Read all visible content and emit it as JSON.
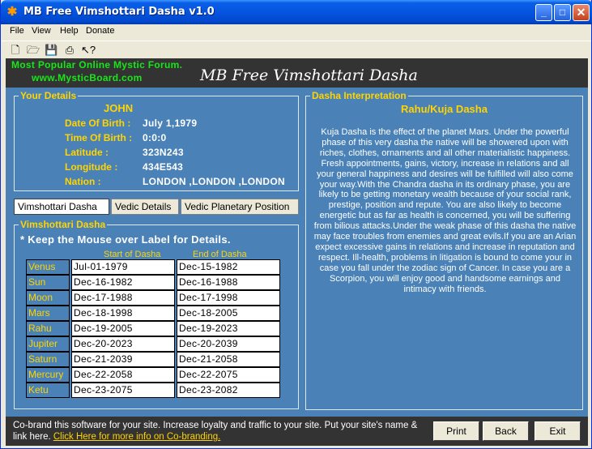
{
  "window": {
    "title": "MB Free  Vimshottari Dasha v1.0",
    "app_icon": "asterisk-icon",
    "controls": [
      "minimize-icon",
      "maximize-icon",
      "close-icon"
    ]
  },
  "menu": [
    "File",
    "View",
    "Help",
    "Donate"
  ],
  "toolbar": [
    "new-icon",
    "open-icon",
    "save-icon",
    "print-icon",
    "help-pointer-icon"
  ],
  "header": {
    "line1": "Most Popular Online Mystic Forum.",
    "line2": "www.MysticBoard.com",
    "title": "MB Free Vimshottari Dasha"
  },
  "details": {
    "group_label": "Your Details",
    "name": "JOHN",
    "rows": [
      {
        "label": "Date Of Birth :",
        "value": "July 1,1979"
      },
      {
        "label": "Time Of Birth :",
        "value": "0:0:0"
      },
      {
        "label": "Latitude  :",
        "value": "323N243"
      },
      {
        "label": "Longitude :",
        "value": "434E543"
      },
      {
        "label": "Nation :",
        "value": "LONDON ,LONDON ,LONDON"
      }
    ]
  },
  "tabs": [
    "Vimshottari Dasha",
    "Vedic Details",
    "Vedic Planetary Position"
  ],
  "vimshottari": {
    "group_label": "Vimshottari Dasha",
    "hint": "* Keep the Mouse over Label  for Details.",
    "col_start": "Start of Dasha",
    "col_end": "End of Dasha",
    "rows": [
      {
        "planet": "Venus",
        "start": "Jul-01-1979",
        "end": "Dec-15-1982"
      },
      {
        "planet": "Sun",
        "start": "Dec-16-1982",
        "end": "Dec-16-1988"
      },
      {
        "planet": "Moon",
        "start": "Dec-17-1988",
        "end": "Dec-17-1998"
      },
      {
        "planet": "Mars",
        "start": "Dec-18-1998",
        "end": "Dec-18-2005"
      },
      {
        "planet": "Rahu",
        "start": "Dec-19-2005",
        "end": "Dec-19-2023"
      },
      {
        "planet": "Jupiter",
        "start": "Dec-20-2023",
        "end": "Dec-20-2039"
      },
      {
        "planet": "Saturn",
        "start": "Dec-21-2039",
        "end": "Dec-21-2058"
      },
      {
        "planet": "Mercury",
        "start": "Dec-22-2058",
        "end": "Dec-22-2075"
      },
      {
        "planet": "Ketu",
        "start": "Dec-23-2075",
        "end": "Dec-23-2082"
      }
    ]
  },
  "interpretation": {
    "group_label": "Dasha Interpretation",
    "title": "Rahu/Kuja Dasha",
    "text": "Kuja Dasha is the effect of the planet Mars. Under the powerful phase of this very dasha the native will be showered upon with riches, clothes, ornaments and all other materialistic happiness. Fresh appointments, gains, victory, increase in relations and all your general happiness and desires will be fulfilled will also come your way.With the Chandra dasha in its ordinary phase, you are likely to be getting monetary wealth because of your social rank, prestige, position and repute. You are also likely to become energetic but as far as health is concerned, you will be suffering from bilious attacks.Under the weak phase of this dasha the native may face troubles from enemies and great evils.If you are an Arian expect excessive gains in relations and increase in reputation and respect. Ill-health, problems in litigation is bound to come your in case you fall under the zodiac sign of Cancer. In case you are a Scorpion, you will enjoy good and handsome earnings and intimacy with friends."
  },
  "footer": {
    "text": "Co-brand this software for your site.  Increase loyalty and traffic to your site. Put your site's name & link here. ",
    "link": "Click Here for more info on Co-branding.",
    "buttons": {
      "print": "Print",
      "back": "Back",
      "exit": "Exit"
    }
  }
}
